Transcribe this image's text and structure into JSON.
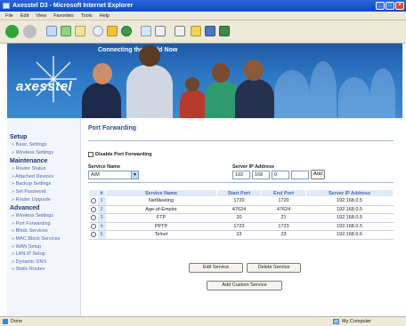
{
  "window": {
    "title": "Axesstel D3 - Microsoft Internet Explorer"
  },
  "menu": {
    "items": [
      "File",
      "Edit",
      "View",
      "Favorites",
      "Tools",
      "Help"
    ]
  },
  "banner": {
    "tagline": "Connecting the World Now",
    "logo": "axesstel"
  },
  "sidebar": {
    "sections": [
      {
        "heading": "Setup",
        "items": [
          "Basic Settings",
          "Wireless Settings"
        ]
      },
      {
        "heading": "Maintenance",
        "items": [
          "Router Status",
          "Attached Devices",
          "Backup Settings",
          "Set Password",
          "Router Upgrade"
        ]
      },
      {
        "heading": "Advanced",
        "items": [
          "Wireless Settings",
          "Port Forwarding",
          "Block Services",
          "MAC Block Services",
          "WAN Setup",
          "LAN IP Setup",
          "Dynamic DNS",
          "Static Routes"
        ]
      }
    ]
  },
  "main": {
    "title": "Port Forwarding",
    "disable_label": "Disable Port Forwarding",
    "service_name_label": "Service Name",
    "service_name_value": "AIM",
    "server_ip_label": "Server IP Address",
    "ip": [
      "192",
      "168",
      "0",
      ""
    ],
    "add_label": "Add",
    "table": {
      "headers": [
        "#",
        "Service Name",
        "Start Port",
        "End Port",
        "Server IP Address"
      ],
      "rows": [
        {
          "num": "1",
          "name": "NetMeeting",
          "start": "1720",
          "end": "1720",
          "ip": "192.168.0.5"
        },
        {
          "num": "2",
          "name": "Age-of-Empire",
          "start": "47624",
          "end": "47624",
          "ip": "192.168.0.5"
        },
        {
          "num": "3",
          "name": "FTP",
          "start": "20",
          "end": "21",
          "ip": "192.168.0.5"
        },
        {
          "num": "4",
          "name": "PPTP",
          "start": "1723",
          "end": "1723",
          "ip": "192.168.0.5"
        },
        {
          "num": "5",
          "name": "Telnet",
          "start": "23",
          "end": "23",
          "ip": "192.168.0.6"
        }
      ]
    },
    "edit_label": "Edit Service",
    "delete_label": "Delete Service",
    "add_custom_label": "Add Custom Service"
  },
  "status": {
    "left": "Done",
    "right": "My Computer"
  }
}
